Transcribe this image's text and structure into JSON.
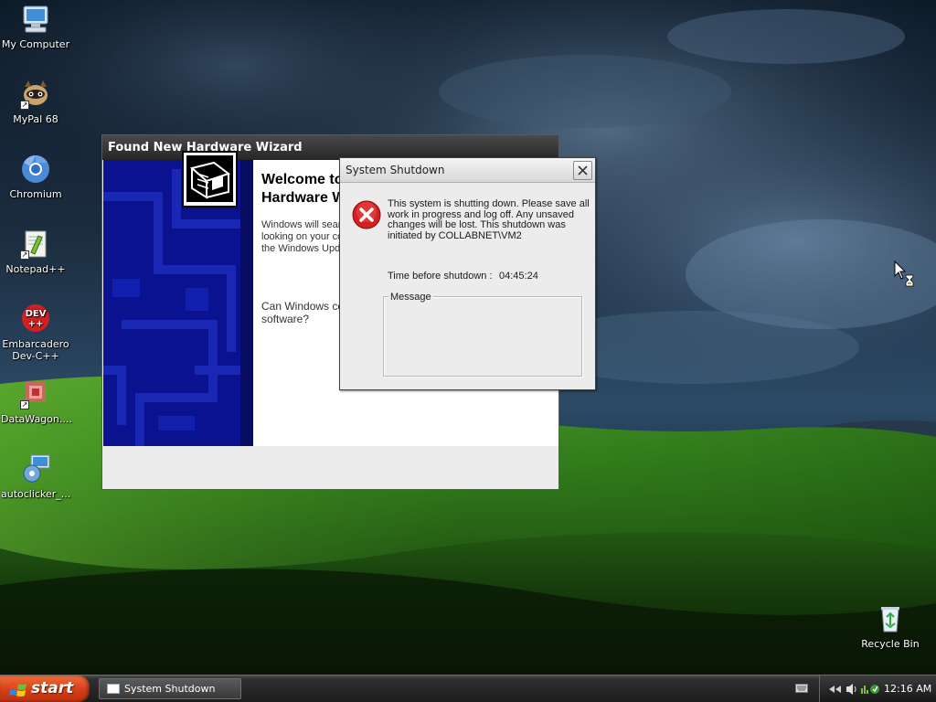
{
  "desktop": {
    "icons": [
      {
        "label": "My Computer",
        "icon": "computer-icon"
      },
      {
        "label": "MyPal 68",
        "icon": "raccoon-icon"
      },
      {
        "label": "Chromium",
        "icon": "chromium-icon"
      },
      {
        "label": "Notepad++",
        "icon": "notepadpp-icon"
      },
      {
        "label": "Embarcadero Dev-C++",
        "line1": "Embarcadero",
        "line2": "Dev-C++",
        "icon": "devcpp-icon",
        "badge": "DEV\n++"
      },
      {
        "label": "DataWagon....",
        "icon": "datawagon-icon"
      },
      {
        "label": "autoclicker_...",
        "icon": "autoclicker-icon"
      },
      {
        "label": "Recycle Bin",
        "icon": "recycle-bin-icon"
      }
    ]
  },
  "wizard": {
    "title": "Found New Hardware Wizard",
    "heading_line1": "Welcome to the Found New",
    "heading_line2": "Hardware Wizard",
    "body_line1": "Windows will search for current and updated software by",
    "body_line2": "looking on your computer, on the hardware installation CD, or on",
    "body_line3": "the Windows Update Web site (with your permission).",
    "question": "Can Windows connect to Windows Update to search for software?"
  },
  "shutdown_dialog": {
    "title": "System Shutdown",
    "message_line1": "This system is shutting down. Please save all",
    "message_line2": "work in progress and log off. Any unsaved",
    "message_line3": "changes will be lost. This shutdown was",
    "message_line4": "initiated by COLLABNET\\VM2",
    "time_label": "Time before shutdown :",
    "time_value": "04:45:24",
    "message_group_label": "Message",
    "message_text": ""
  },
  "taskbar": {
    "start_label": "start",
    "task_label": "System Shutdown",
    "clock": "12:16 AM"
  },
  "colors": {
    "start_button": "#d8401a",
    "wizard_sidepanel": "#0b1290",
    "error_icon": "#d42020"
  }
}
